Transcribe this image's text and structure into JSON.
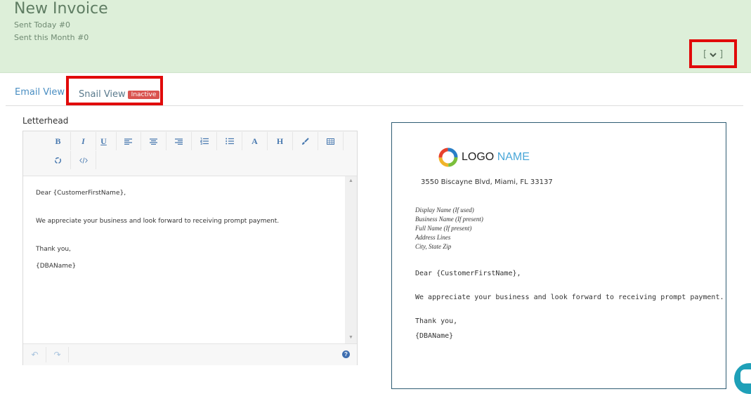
{
  "header": {
    "title": "New Invoice",
    "sent_today": "Sent Today #0",
    "sent_month": "Sent this Month #0",
    "collapse_open": "[",
    "collapse_close": "]",
    "collapse_icon": "chevron-down-icon"
  },
  "tabs": {
    "email_view": "Email View",
    "snail_view": "Snail View",
    "snail_badge": "Inactive"
  },
  "editor": {
    "label": "Letterhead",
    "toolbar_row1": [
      {
        "name": "bold",
        "glyph": "B"
      },
      {
        "name": "italic",
        "glyph": "I"
      },
      {
        "name": "underline",
        "glyph": "U"
      },
      {
        "name": "align-left",
        "glyph": "≡"
      },
      {
        "name": "align-center",
        "glyph": "≡"
      },
      {
        "name": "align-right",
        "glyph": "≡"
      },
      {
        "name": "ordered-list",
        "glyph": "☰"
      },
      {
        "name": "unordered-list",
        "glyph": "☰"
      },
      {
        "name": "font-color",
        "glyph": "A"
      },
      {
        "name": "heading",
        "glyph": "H"
      },
      {
        "name": "brush",
        "glyph": "🖌"
      },
      {
        "name": "table",
        "glyph": "▦"
      }
    ],
    "toolbar_row2": [
      {
        "name": "recycle",
        "glyph": "♻"
      },
      {
        "name": "code",
        "glyph": "</>"
      }
    ],
    "content": {
      "greeting": "Dear {CustomerFirstName},",
      "body": "We appreciate your business and look forward to receiving prompt payment.",
      "closing": "Thank you,",
      "signature": "{DBAName}"
    },
    "footer": {
      "undo": "↶",
      "redo": "↷",
      "help": "?"
    }
  },
  "preview": {
    "logo_word": "LOGO",
    "logo_name": "NAME",
    "address": "3550 Biscayne Blvd, Miami, FL 33137",
    "recipient_lines": [
      "Display Name (If used)",
      "Business Name (If present)",
      "Full Name (If present)",
      "Address Lines",
      "City, State Zip"
    ],
    "greeting": "Dear {CustomerFirstName},",
    "body": "We appreciate your business and look forward to receiving prompt payment.",
    "closing": "Thank you,",
    "signature": "{DBAName}"
  },
  "colors": {
    "header_bg": "#ddefd9",
    "highlight": "#e10a0a",
    "badge_bg": "#d9534f",
    "tab_text": "#4a8ec2",
    "preview_border": "#2f5c73",
    "chat_widget": "#1ea0b8"
  }
}
